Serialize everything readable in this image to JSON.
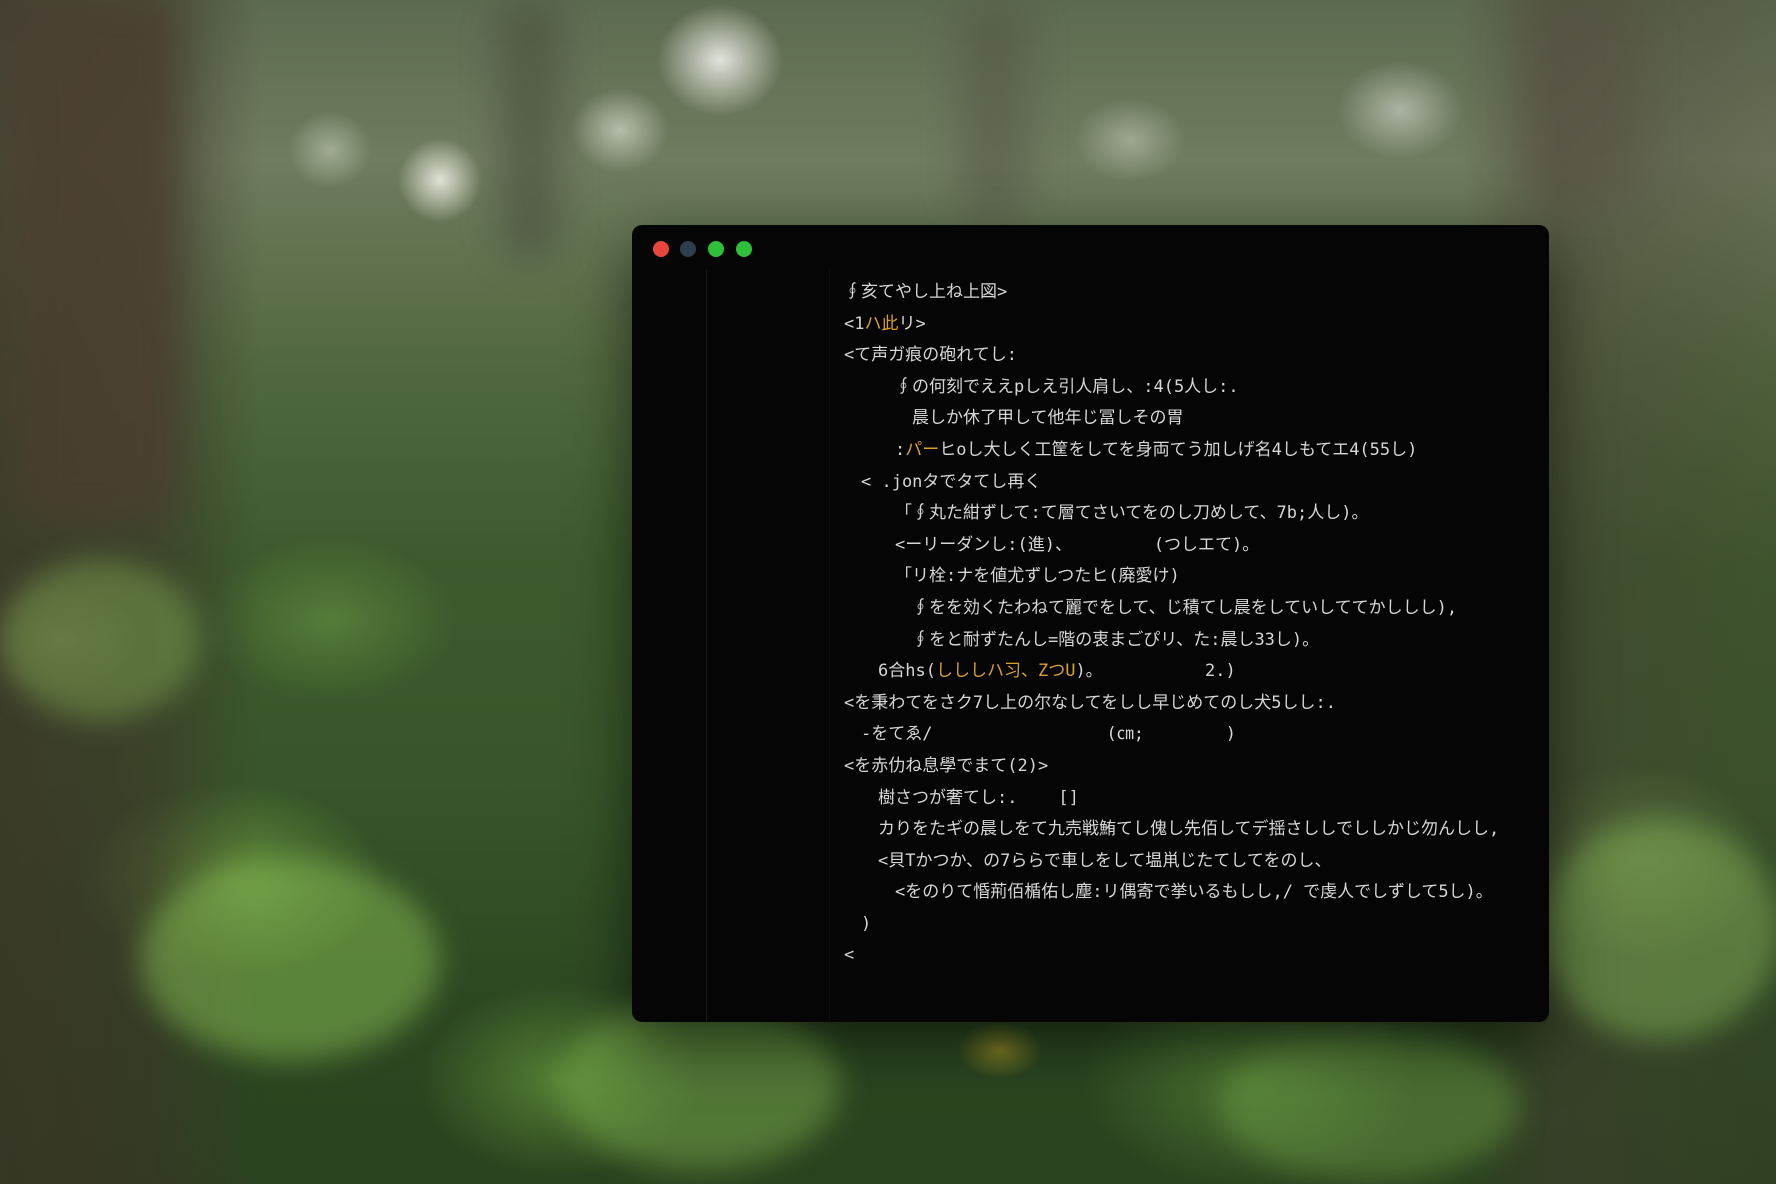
{
  "window": {
    "controls": [
      {
        "name": "close",
        "color": "#e8453c"
      },
      {
        "name": "minimize",
        "color": "#2f3e4c"
      },
      {
        "name": "zoom",
        "color": "#2fbf3b"
      },
      {
        "name": "extra",
        "color": "#2fbf3b"
      }
    ]
  },
  "editor": {
    "colors": {
      "background": "#050505",
      "text": "#d6d6d6",
      "accent": "#d9a12e"
    },
    "lines": [
      {
        "indent": 0,
        "segments": [
          {
            "text": "∮亥てやし上ね上図>",
            "accent": false
          }
        ]
      },
      {
        "indent": 0,
        "segments": [
          {
            "text": "<1",
            "accent": false
          },
          {
            "text": "ハ此",
            "accent": true
          },
          {
            "text": "リ>",
            "accent": false
          }
        ]
      },
      {
        "indent": 0,
        "segments": [
          {
            "text": "<て声ガ痕の砲れてし:",
            "accent": false
          }
        ]
      },
      {
        "indent": 3,
        "segments": [
          {
            "text": "∮の何刻でええpしえ引人肩し、:4(5人し:.",
            "accent": false
          }
        ]
      },
      {
        "indent": 4,
        "segments": [
          {
            "text": "晨しか休了甲して他年じ冨しその胃",
            "accent": false
          }
        ]
      },
      {
        "indent": 3,
        "segments": [
          {
            "text": ":",
            "accent": false
          },
          {
            "text": "パー",
            "accent": true
          },
          {
            "text": "ヒoし大しく工筐をしてを身両てう加しげ名4しもてエ4(55し)",
            "accent": false
          }
        ]
      },
      {
        "indent": 1,
        "segments": [
          {
            "text": "< .jonタでタてし再く",
            "accent": false
          }
        ]
      },
      {
        "indent": 3,
        "segments": [
          {
            "text": "「∮丸た紺ずして:て層てさいてをのし刀めして、7b;人し)。",
            "accent": false
          }
        ]
      },
      {
        "indent": 3,
        "segments": [
          {
            "text": "<ーリーダンし:(進)、        (つしエて)。",
            "accent": false
          }
        ]
      },
      {
        "indent": 3,
        "segments": [
          {
            "text": "「リ栓:ナを値尤ずしつたヒ(廃愛け)",
            "accent": false
          }
        ]
      },
      {
        "indent": 4,
        "segments": [
          {
            "text": "∮をを効くたわねて麗でをして、じ積てし晨をしていしててかししし),",
            "accent": false
          }
        ]
      },
      {
        "indent": 4,
        "segments": [
          {
            "text": "∮をと耐ずたんし=階の衷まごぴリ、た:晨し33し)。",
            "accent": false
          }
        ]
      },
      {
        "indent": 2,
        "segments": [
          {
            "text": "6合hs(",
            "accent": false
          },
          {
            "text": "しししハ习、ZつU",
            "accent": true
          },
          {
            "text": ")。          2.)",
            "accent": false
          }
        ]
      },
      {
        "indent": 0,
        "segments": [
          {
            "text": "<を秉わてをさク7し上の尔なしてをしし早じめてのし犬5しし:.",
            "accent": false
          }
        ]
      },
      {
        "indent": 1,
        "segments": [
          {
            "text": "-をてゑ/                 (㎝;        )",
            "accent": false
          }
        ]
      },
      {
        "indent": 0,
        "segments": [
          {
            "text": "<を赤仂ね息學でまて(2)>",
            "accent": false
          }
        ]
      },
      {
        "indent": 2,
        "segments": [
          {
            "text": "樹さつが奢てし:.    []",
            "accent": false
          }
        ]
      },
      {
        "indent": 2,
        "segments": [
          {
            "text": "カりをたギの晨しをて九売戦鮪てし傀し先佰してデ揺さししでししかじ勿んしし,",
            "accent": false
          }
        ]
      },
      {
        "indent": 2,
        "segments": [
          {
            "text": "<貝Tかつか、の7ららで車しをして塭鼡じたてしてをのし、",
            "accent": false
          }
        ]
      },
      {
        "indent": 3,
        "segments": [
          {
            "text": "<をのりて惛荊佰楯佑し塵:リ偶寄で挙いるもしし,/ で虔人でしずして5し)。",
            "accent": false
          }
        ]
      },
      {
        "indent": 1,
        "segments": [
          {
            "text": ")",
            "accent": false
          }
        ]
      },
      {
        "indent": 0,
        "segments": [
          {
            "text": "<",
            "accent": false
          }
        ]
      }
    ]
  }
}
